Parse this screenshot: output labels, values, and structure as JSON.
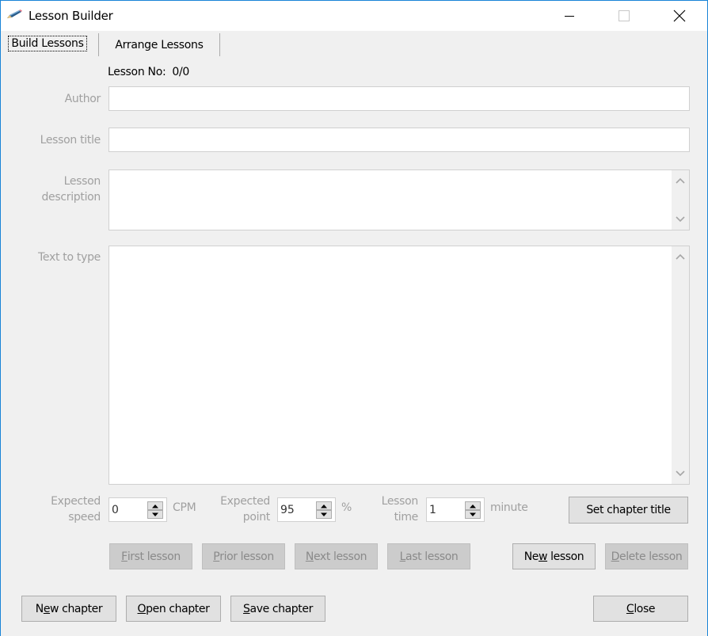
{
  "window": {
    "title": "Lesson Builder",
    "icon": "pencil-icon",
    "controls": [
      "minimize-icon",
      "maximize-icon",
      "close-icon"
    ]
  },
  "tabs": [
    {
      "label": "Build Lessons",
      "active": true
    },
    {
      "label": "Arrange Lessons",
      "active": false
    }
  ],
  "lesson_no": {
    "label": "Lesson No:",
    "value": "0/0"
  },
  "fields": {
    "author": {
      "label": "Author",
      "value": ""
    },
    "lesson_title": {
      "label": "Lesson title",
      "value": ""
    },
    "lesson_description": {
      "label_line1": "Lesson",
      "label_line2": "description",
      "value": ""
    },
    "text_to_type": {
      "label": "Text to type",
      "value": ""
    }
  },
  "spinners": {
    "expected_speed": {
      "label_line1": "Expected",
      "label_line2": "speed",
      "value": "0",
      "unit": "CPM"
    },
    "expected_point": {
      "label_line1": "Expected",
      "label_line2": "point",
      "value": "95",
      "unit": "%"
    },
    "lesson_time": {
      "label_line1": "Lesson",
      "label_line2": "time",
      "value": "1",
      "unit": "minute"
    }
  },
  "buttons": {
    "set_chapter_title": {
      "label": "Set chapter title",
      "enabled": true
    },
    "first_lesson": {
      "mnemonic": "F",
      "rest": "irst lesson",
      "enabled": false
    },
    "prior_lesson": {
      "mnemonic": "P",
      "rest": "rior lesson",
      "enabled": false
    },
    "next_lesson": {
      "mnemonic": "N",
      "rest": "ext lesson",
      "enabled": false
    },
    "last_lesson": {
      "mnemonic": "L",
      "rest": "ast lesson",
      "enabled": false
    },
    "new_lesson": {
      "pre": "Ne",
      "mnemonic": "w",
      "rest": " lesson",
      "enabled": true
    },
    "delete_lesson": {
      "mnemonic": "D",
      "rest": "elete lesson",
      "enabled": false
    },
    "new_chapter": {
      "pre": "N",
      "mnemonic": "e",
      "rest": "w chapter",
      "enabled": true
    },
    "open_chapter": {
      "mnemonic": "O",
      "rest": "pen chapter",
      "enabled": true
    },
    "save_chapter": {
      "mnemonic": "S",
      "rest": "ave chapter",
      "enabled": true
    },
    "close": {
      "mnemonic": "C",
      "rest": "lose",
      "enabled": true
    }
  },
  "colors": {
    "window_border": "#1883d7",
    "background": "#f0f0f0",
    "disabled_text": "#a0a0a0",
    "button_face": "#e1e1e1"
  }
}
